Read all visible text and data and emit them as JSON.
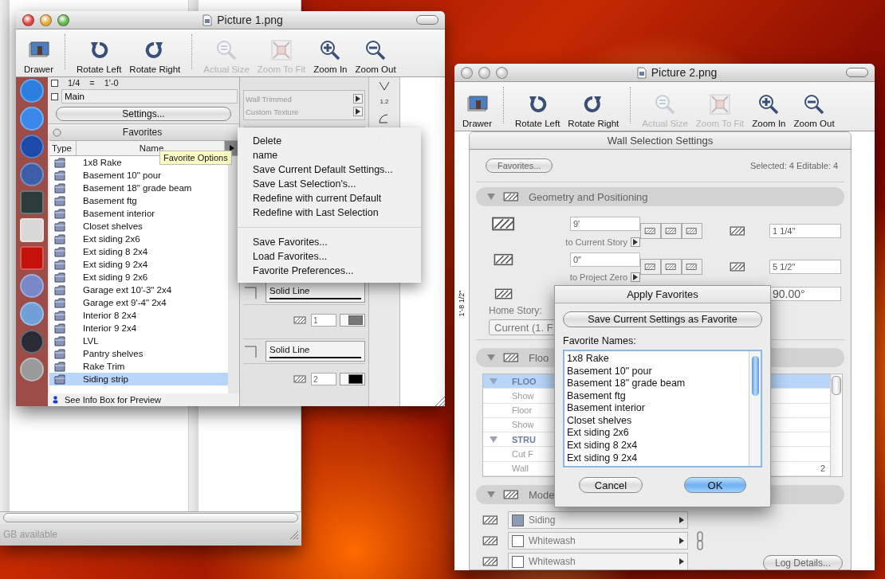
{
  "back_window": {
    "status": "GB available"
  },
  "left_window": {
    "title": "Picture 1.png",
    "toolbar": [
      {
        "kind": "drawer",
        "label": "Drawer",
        "disabled": false
      },
      {
        "kind": "rotate_left",
        "label": "Rotate Left",
        "disabled": false
      },
      {
        "kind": "rotate_right",
        "label": "Rotate Right",
        "disabled": false
      },
      {
        "kind": "actual_size",
        "label": "Actual Size",
        "disabled": true
      },
      {
        "kind": "zoom_fit",
        "label": "Zoom To Fit",
        "disabled": true
      },
      {
        "kind": "zoom_in",
        "label": "Zoom In",
        "disabled": false
      },
      {
        "kind": "zoom_out",
        "label": "Zoom Out",
        "disabled": false
      }
    ],
    "palette": {
      "scale": "1/4",
      "scale_equals": "=",
      "scale_value": "1'-0",
      "layer": "Main",
      "settings_button": "Settings...",
      "favorites_title": "Favorites",
      "columns": [
        "Type",
        "Name"
      ],
      "favorites": [
        {
          "name": "1x8 Rake",
          "selected": false
        },
        {
          "name": "Basement 10\" pour",
          "selected": false
        },
        {
          "name": "Basement 18\" grade beam",
          "selected": false
        },
        {
          "name": "Basement ftg",
          "selected": false
        },
        {
          "name": "Basement interior",
          "selected": false
        },
        {
          "name": "Closet shelves",
          "selected": false
        },
        {
          "name": "Ext siding 2x6",
          "selected": false
        },
        {
          "name": "Ext siding 8 2x4",
          "selected": false
        },
        {
          "name": "Ext siding 9 2x4",
          "selected": false
        },
        {
          "name": "Ext siding 9 2x6",
          "selected": false
        },
        {
          "name": "Garage ext 10'-3\" 2x4",
          "selected": false
        },
        {
          "name": "Garage ext 9'-4\" 2x4",
          "selected": false
        },
        {
          "name": "Interior 8 2x4",
          "selected": false
        },
        {
          "name": "Interior 9 2x4",
          "selected": false
        },
        {
          "name": "LVL",
          "selected": false
        },
        {
          "name": "Pantry shelves",
          "selected": false
        },
        {
          "name": "Rake Trim",
          "selected": false
        },
        {
          "name": "Siding strip",
          "selected": true
        }
      ],
      "footer": "See Info Box for Preview"
    },
    "options": {
      "flags": [
        "Wall Trimmed",
        "Custom Texture"
      ],
      "dimension_mark": "1.2",
      "line_types": [
        {
          "label": "Solid Line",
          "pen": "1"
        },
        {
          "label": "Solid Line",
          "pen": "2"
        }
      ]
    },
    "menu": {
      "sections": [
        [
          "Delete",
          "name",
          "Save Current Default Settings...",
          "Save Last Selection's...",
          "Redefine with current Default",
          "Redefine with Last Selection"
        ],
        [
          "Save Favorites...",
          "Load Favorites...",
          "Favorite Preferences..."
        ]
      ]
    },
    "tooltip": "Favorite Options"
  },
  "right_window": {
    "title": "Picture 2.png",
    "dimension_label": "1'-8 1/2\"",
    "toolbar": [
      {
        "kind": "drawer",
        "label": "Drawer",
        "disabled": false
      },
      {
        "kind": "rotate_left",
        "label": "Rotate Left",
        "disabled": false
      },
      {
        "kind": "rotate_right",
        "label": "Rotate Right",
        "disabled": false
      },
      {
        "kind": "actual_size",
        "label": "Actual Size",
        "disabled": true
      },
      {
        "kind": "zoom_fit",
        "label": "Zoom To Fit",
        "disabled": true
      },
      {
        "kind": "zoom_in",
        "label": "Zoom In",
        "disabled": false
      },
      {
        "kind": "zoom_out",
        "label": "Zoom Out",
        "disabled": false
      }
    ],
    "settings": {
      "title": "Wall Selection Settings",
      "favorites_button": "Favorites...",
      "selection_info": "Selected: 4 Editable: 4",
      "geometry": {
        "title": "Geometry and Positioning",
        "expanded": true,
        "height": "9'",
        "height_ref": "to Current Story",
        "base": "0\"",
        "base_ref": "to Project Zero",
        "thickness": "1 1/4\"",
        "offset": "5 1/2\"",
        "angle": "90.00°",
        "home_story_label": "Home Story:",
        "home_story": "Current (1. F"
      },
      "floor": {
        "title": "Floo",
        "expanded": true,
        "rows": [
          {
            "kind": "group",
            "name": "FLOO",
            "expanded": true,
            "selected": true
          },
          {
            "kind": "item",
            "name": "Show",
            "selected": false
          },
          {
            "kind": "item",
            "name": "Floor",
            "selected": false
          },
          {
            "kind": "item",
            "name": "Show",
            "selected": false
          },
          {
            "kind": "group",
            "name": "STRU",
            "expanded": true,
            "selected": false
          },
          {
            "kind": "item",
            "name": "Cut F",
            "selected": false
          },
          {
            "kind": "item",
            "name": "Wall",
            "selected": false,
            "value": "2"
          }
        ]
      },
      "model": {
        "title": "Mode",
        "expanded": true,
        "surfaces": [
          {
            "name": "Siding",
            "color": "#8e9bb5"
          },
          {
            "name": "Whitewash",
            "color": "#ffffff"
          },
          {
            "name": "Whitewash",
            "color": "#ffffff"
          }
        ],
        "log_button": "Log Details..."
      }
    },
    "dialog": {
      "title": "Apply Favorites",
      "save_button": "Save Current Settings as Favorite",
      "list_label": "Favorite Names:",
      "names": [
        "1x8 Rake",
        "Basement 10\" pour",
        "Basement 18\" grade beam",
        "Basement ftg",
        "Basement interior",
        "Closet shelves",
        "Ext siding 2x6",
        "Ext siding 8 2x4",
        "Ext siding 9 2x4"
      ],
      "cancel_button": "Cancel",
      "ok_button": "OK"
    }
  }
}
